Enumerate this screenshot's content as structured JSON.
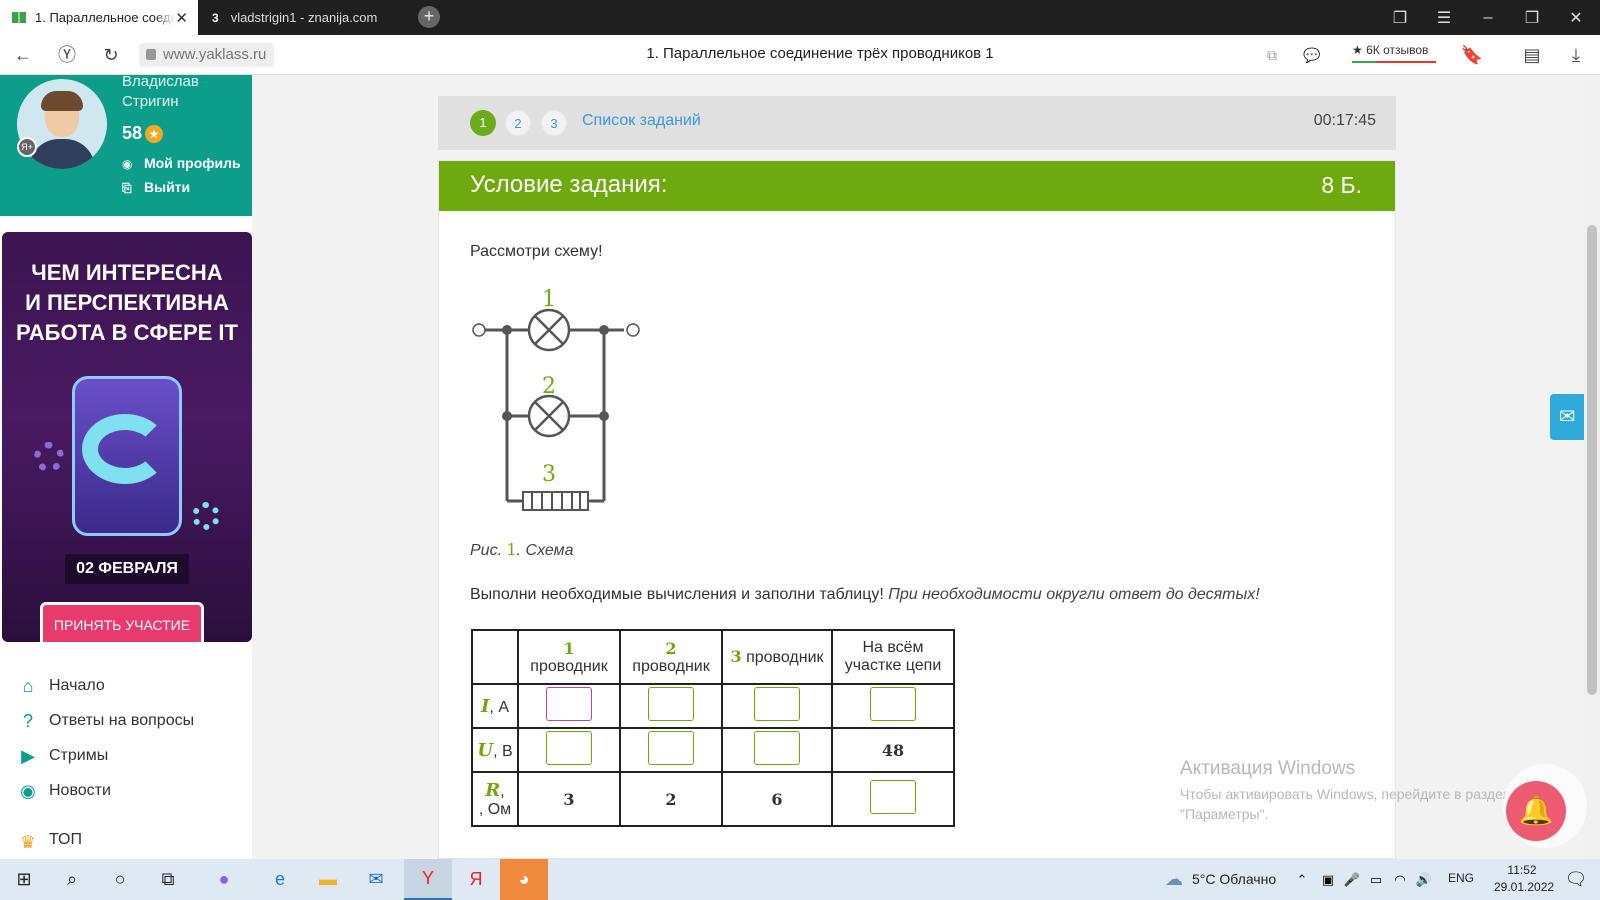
{
  "browser": {
    "tabs": [
      {
        "label": "1. Параллельное соеди"
      },
      {
        "label": "vladstrigin1 - znanija.com",
        "favicon": "3"
      }
    ],
    "url": "www.yaklass.ru",
    "page_title": "1. Параллельное соединение трёх проводников 1",
    "reviews": "★ 6К отзывов"
  },
  "profile": {
    "name_line1": "Владислав",
    "name_line2": "Стригин",
    "points": "58",
    "my_profile": "Мой профиль",
    "logout": "Выйти"
  },
  "ad": {
    "title_line1": "ЧЕМ ИНТЕРЕСНА",
    "title_line2": "И ПЕРСПЕКТИВНА",
    "title_line3": "РАБОТА В СФЕРЕ IT",
    "date": "02 ФЕВРАЛЯ",
    "button": "ПРИНЯТЬ УЧАСТИЕ"
  },
  "menu": {
    "items": [
      {
        "label": "Начало",
        "icon": "home-icon"
      },
      {
        "label": "Ответы на вопросы",
        "icon": "question-icon"
      },
      {
        "label": "Стримы",
        "icon": "play-icon"
      },
      {
        "label": "Новости",
        "icon": "news-icon"
      },
      {
        "label": "ТОП",
        "icon": "crown-icon"
      }
    ]
  },
  "task_nav": {
    "numbers": [
      "1",
      "2",
      "3"
    ],
    "list_label": "Список заданий",
    "timer": "00:17:45"
  },
  "task": {
    "header": "Условие задания:",
    "points": "8 Б.",
    "prompt": "Рассмотри схему!",
    "circuit_labels": [
      "1",
      "2",
      "3"
    ],
    "caption_prefix": "Рис.",
    "caption_num": "1",
    "caption_text": ". Схема",
    "instruction": "Выполни необходимые вычисления и заполни таблицу!",
    "instruction_italic": "При необходимости округли ответ до десятых!"
  },
  "table": {
    "headers": {
      "c1_num": "1",
      "c1_text": "проводник",
      "c2_num": "2",
      "c2_text": "проводник",
      "c3_num": "3",
      "c3_text": "проводник",
      "c4": "На всём участке цепи"
    },
    "rows": {
      "I": {
        "var": "I",
        "unit": ", А"
      },
      "U": {
        "var": "U",
        "unit": ", В",
        "total": "48"
      },
      "R": {
        "var": "R",
        "unit": ", Ом",
        "r1": "3",
        "r2": "2",
        "r3": "6"
      }
    }
  },
  "windows": {
    "activation_title": "Активация Windows",
    "activation_text": "Чтобы активировать Windows, перейдите в раздел \"Параметры\"."
  },
  "taskbar": {
    "weather": "5°C  Облачно",
    "lang": "ENG",
    "time": "11:52",
    "date": "29.01.2022"
  }
}
